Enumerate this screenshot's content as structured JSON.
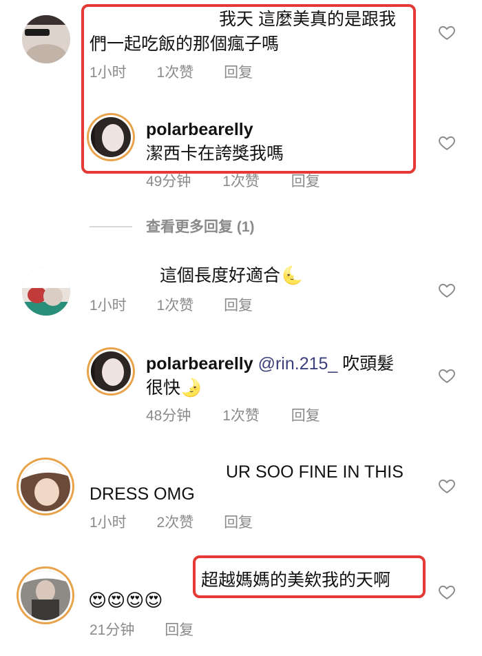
{
  "comments": [
    {
      "text": "我天 這麼美真的是跟我",
      "text2": "們一起吃飯的那個瘋子嗎",
      "time": "1小时",
      "likes": "1次赞",
      "reply": "回复",
      "replies": [
        {
          "username": "polarbearelly",
          "text": "潔西卡在誇獎我嗎",
          "time": "49分钟",
          "likes": "1次赞",
          "reply": "回复"
        }
      ],
      "view_more": "查看更多回复 (1)"
    },
    {
      "text": "這個長度好適合",
      "emoji": "🌜",
      "time": "1小时",
      "likes": "1次赞",
      "reply": "回复",
      "replies": [
        {
          "username": "polarbearelly",
          "mention": "@rin.215_",
          "text": "吹頭髮",
          "text2": "很快",
          "emoji": "🌛",
          "time": "48分钟",
          "likes": "1次赞",
          "reply": "回复"
        }
      ]
    },
    {
      "text": "UR SOO FINE IN THIS",
      "text2": "DRESS OMG",
      "time": "1小时",
      "likes": "2次赞",
      "reply": "回复"
    },
    {
      "text": "超越媽媽的美欸我的天啊",
      "emoji": "😍😍😍😍",
      "time": "21分钟",
      "reply": "回复"
    }
  ],
  "colors": {
    "highlight_box": "#e53935",
    "meta_text": "#8a8a8a",
    "mention": "#3b3f7a",
    "story_ring": "#e8a24a"
  },
  "icons": {
    "like": "heart-outline-icon"
  }
}
